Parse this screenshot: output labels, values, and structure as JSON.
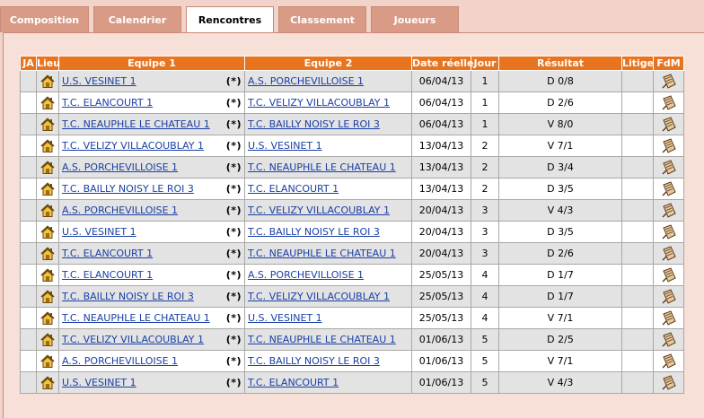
{
  "tabs": [
    {
      "label": "Composition",
      "active": false
    },
    {
      "label": "Calendrier",
      "active": false
    },
    {
      "label": "Rencontres",
      "active": true
    },
    {
      "label": "Classement",
      "active": false
    },
    {
      "label": "Joueurs",
      "active": false
    }
  ],
  "table": {
    "headers": {
      "ja": "JA",
      "lieu": "Lieu",
      "equipe1": "Equipe 1",
      "equipe2": "Equipe 2",
      "date": "Date réelle",
      "jour": "Jour",
      "resultat": "Résultat",
      "litige": "Litige",
      "fdm": "FdM"
    },
    "star_marker": "(*)",
    "rows": [
      {
        "team1": "U.S. VESINET 1",
        "team2": "A.S. PORCHEVILLOISE 1",
        "date": "06/04/13",
        "jour": "1",
        "result": "D 0/8"
      },
      {
        "team1": "T.C. ELANCOURT 1",
        "team2": "T.C. VELIZY VILLACOUBLAY 1",
        "date": "06/04/13",
        "jour": "1",
        "result": "D 2/6"
      },
      {
        "team1": "T.C. NEAUPHLE LE CHATEAU 1",
        "team2": "T.C. BAILLY NOISY LE ROI 3",
        "date": "06/04/13",
        "jour": "1",
        "result": "V 8/0"
      },
      {
        "team1": "T.C. VELIZY VILLACOUBLAY 1",
        "team2": "U.S. VESINET 1",
        "date": "13/04/13",
        "jour": "2",
        "result": "V 7/1"
      },
      {
        "team1": "A.S. PORCHEVILLOISE 1",
        "team2": "T.C. NEAUPHLE LE CHATEAU 1",
        "date": "13/04/13",
        "jour": "2",
        "result": "D 3/4"
      },
      {
        "team1": "T.C. BAILLY NOISY LE ROI 3",
        "team2": "T.C. ELANCOURT 1",
        "date": "13/04/13",
        "jour": "2",
        "result": "D 3/5"
      },
      {
        "team1": "A.S. PORCHEVILLOISE 1",
        "team2": "T.C. VELIZY VILLACOUBLAY 1",
        "date": "20/04/13",
        "jour": "3",
        "result": "V 4/3"
      },
      {
        "team1": "U.S. VESINET 1",
        "team2": "T.C. BAILLY NOISY LE ROI 3",
        "date": "20/04/13",
        "jour": "3",
        "result": "D 3/5"
      },
      {
        "team1": "T.C. ELANCOURT 1",
        "team2": "T.C. NEAUPHLE LE CHATEAU 1",
        "date": "20/04/13",
        "jour": "3",
        "result": "D 2/6"
      },
      {
        "team1": "T.C. ELANCOURT 1",
        "team2": "A.S. PORCHEVILLOISE 1",
        "date": "25/05/13",
        "jour": "4",
        "result": "D 1/7"
      },
      {
        "team1": "T.C. BAILLY NOISY LE ROI 3",
        "team2": "T.C. VELIZY VILLACOUBLAY 1",
        "date": "25/05/13",
        "jour": "4",
        "result": "D 1/7"
      },
      {
        "team1": "T.C. NEAUPHLE LE CHATEAU 1",
        "team2": "U.S. VESINET 1",
        "date": "25/05/13",
        "jour": "4",
        "result": "V 7/1"
      },
      {
        "team1": "T.C. VELIZY VILLACOUBLAY 1",
        "team2": "T.C. NEAUPHLE LE CHATEAU 1",
        "date": "01/06/13",
        "jour": "5",
        "result": "D 2/5"
      },
      {
        "team1": "A.S. PORCHEVILLOISE 1",
        "team2": "T.C. BAILLY NOISY LE ROI 3",
        "date": "01/06/13",
        "jour": "5",
        "result": "V 7/1"
      },
      {
        "team1": "U.S. VESINET 1",
        "team2": "T.C. ELANCOURT 1",
        "date": "01/06/13",
        "jour": "5",
        "result": "V 4/3"
      }
    ]
  },
  "icons": {
    "lieu": "home-icon",
    "fdm": "match-sheet-icon"
  },
  "colors": {
    "header": "#e8741f",
    "tab": "#d99a86",
    "link": "#1a3fa6",
    "row_alt": "#e3e3e3"
  }
}
